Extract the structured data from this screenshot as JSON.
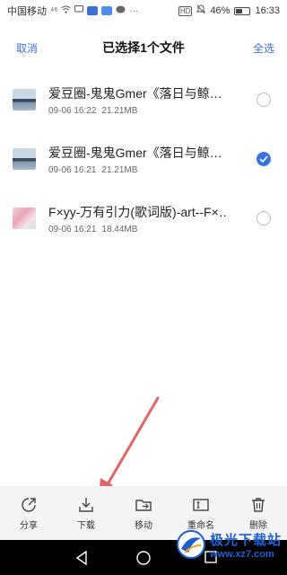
{
  "status_bar": {
    "carrier": "中国移动",
    "signal_text": "⁴⁶",
    "battery": "46%",
    "time": "16:33"
  },
  "header": {
    "cancel": "取消",
    "title": "已选择1个文件",
    "select_all": "全选"
  },
  "files": [
    {
      "name": "爱豆圈-鬼鬼Gmer《落日与鲸…",
      "date": "09-06 16:22",
      "size": "21.21MB",
      "selected": false,
      "thumb": "sea"
    },
    {
      "name": "爱豆圈-鬼鬼Gmer《落日与鲸…",
      "date": "09-06 16:21",
      "size": "21.21MB",
      "selected": true,
      "thumb": "sea"
    },
    {
      "name": "F×yy-万有引力(歌词版)-art--F×…",
      "date": "09-06 16:21",
      "size": "18.44MB",
      "selected": false,
      "thumb": "pink"
    }
  ],
  "toolbar": {
    "share": "分享",
    "download": "下载",
    "move": "移动",
    "rename": "重命名",
    "delete": "删除"
  },
  "watermark": {
    "main": "极光下载站",
    "sub": "www.xz7.com"
  },
  "colors": {
    "accent": "#3a73e0",
    "arrow": "#e06666",
    "toolbar_bg": "#f4f4f6"
  }
}
